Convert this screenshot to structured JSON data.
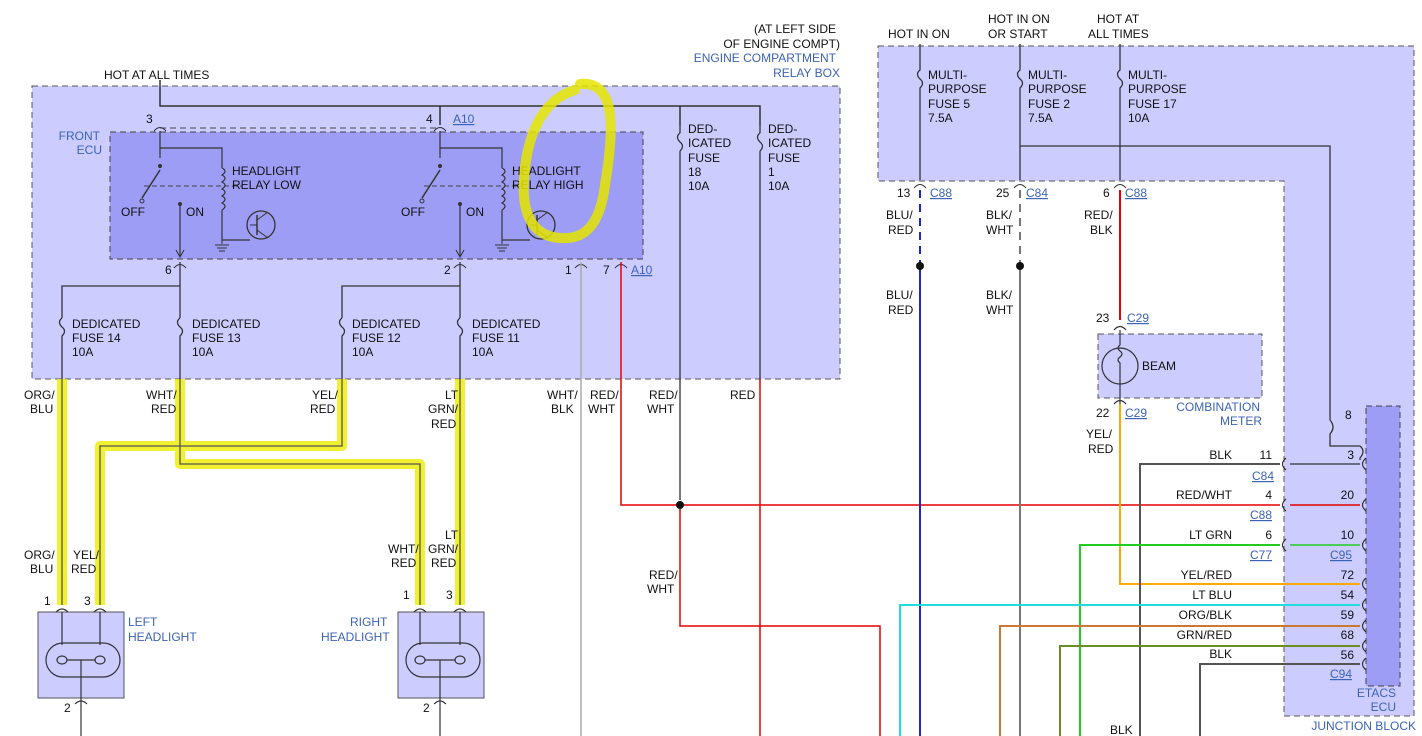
{
  "colors": {
    "box_fill": "#ccccff",
    "ecu_fill": "#9d9df5",
    "wire_red": "#e60000",
    "wire_blue": "#2222cc",
    "wire_gray": "#777777",
    "wire_black": "#222222",
    "wire_green": "#22cc22",
    "wire_cyan": "#22dddd",
    "wire_yellow": "#ffaa00",
    "wire_orange": "#cc7733",
    "wire_olive": "#6b8e23",
    "highlight": "#eeee00"
  },
  "relay_box": {
    "location_l1": "(AT LEFT SIDE",
    "location_l2": "OF ENGINE COMPT)",
    "name_l1": "ENGINE COMPARTMENT",
    "name_l2": "RELAY BOX",
    "hot": "HOT AT ALL TIMES",
    "pin3": "3",
    "pin4": "4",
    "conn_a10": "A10",
    "pin6": "6",
    "pin2": "2",
    "pin1": "1",
    "pin7": "7",
    "conn_a10_b": "A10"
  },
  "front_ecu": {
    "l1": "FRONT",
    "l2": "ECU"
  },
  "relay_low": {
    "l1": "HEADLIGHT",
    "l2": "RELAY LOW",
    "off": "OFF",
    "on": "ON"
  },
  "relay_high": {
    "l1": "HEADLIGHT",
    "l2": "RELAY HIGH",
    "off": "OFF",
    "on": "ON"
  },
  "ded18": {
    "l1": "DED-",
    "l2": "ICATED",
    "l3": "FUSE",
    "l4": "18",
    "l5": "10A"
  },
  "ded1": {
    "l1": "DED-",
    "l2": "ICATED",
    "l3": "FUSE",
    "l4": "1",
    "l5": "10A"
  },
  "fuse14": {
    "l1": "DEDICATED",
    "l2": "FUSE 14",
    "l3": "10A"
  },
  "fuse13": {
    "l1": "DEDICATED",
    "l2": "FUSE 13",
    "l3": "10A"
  },
  "fuse12": {
    "l1": "DEDICATED",
    "l2": "FUSE 12",
    "l3": "10A"
  },
  "fuse11": {
    "l1": "DEDICATED",
    "l2": "FUSE 11",
    "l3": "10A"
  },
  "wires_left": {
    "orgblu_a": "ORG/",
    "orgblu_b": "BLU",
    "whtred_a": "WHT/",
    "whtred_b": "RED",
    "yelred_a": "YEL/",
    "yelred_b": "RED",
    "ltgrnred_a": "LT",
    "ltgrnred_b": "GRN/",
    "ltgrnred_c": "RED",
    "whtblk_a": "WHT/",
    "whtblk_b": "BLK",
    "redwht1_a": "RED/",
    "redwht1_b": "WHT",
    "redwht2_a": "RED/",
    "redwht2_b": "WHT",
    "red": "RED",
    "redwht3_a": "RED/",
    "redwht3_b": "WHT"
  },
  "left_headlight": {
    "l1": "LEFT",
    "l2": "HEADLIGHT",
    "pin1": "1",
    "pin3": "3",
    "pin2": "2",
    "w1a": "ORG/",
    "w1b": "BLU",
    "w3a": "YEL/",
    "w3b": "RED"
  },
  "right_headlight": {
    "l1": "RIGHT",
    "l2": "HEADLIGHT",
    "pin1": "1",
    "pin3": "3",
    "pin2": "2",
    "w1a": "WHT/",
    "w1b": "RED",
    "w3a": "LT",
    "w3b": "GRN/",
    "w3c": "RED"
  },
  "junction": {
    "hot_on": "HOT IN ON",
    "hot_start_l1": "HOT IN ON",
    "hot_start_l2": "OR START",
    "hot_all_l1": "HOT AT",
    "hot_all_l2": "ALL TIMES",
    "fuse5": {
      "l1": "MULTI-",
      "l2": "PURPOSE",
      "l3": "FUSE 5",
      "l4": "7.5A"
    },
    "fuse2": {
      "l1": "MULTI-",
      "l2": "PURPOSE",
      "l3": "FUSE 2",
      "l4": "7.5A"
    },
    "fuse17": {
      "l1": "MULTI-",
      "l2": "PURPOSE",
      "l3": "FUSE 17",
      "l4": "10A"
    },
    "p13": "13",
    "c88a": "C88",
    "p25": "25",
    "c84a": "C84",
    "p6": "6",
    "c88b": "C88",
    "blured_a": "BLU/",
    "blured_b": "RED",
    "blkwht_a": "BLK/",
    "blkwht_b": "WHT",
    "redblk_a": "RED/",
    "redblk_b": "BLK",
    "blured2_a": "BLU/",
    "blured2_b": "RED",
    "blkwht2_a": "BLK/",
    "blkwht2_b": "WHT",
    "name": "JUNCTION BLOCK"
  },
  "combo_meter": {
    "p23": "23",
    "c29a": "C29",
    "beam": "BEAM",
    "p22": "22",
    "c29b": "C29",
    "l1": "COMBINATION",
    "l2": "METER",
    "yelred_a": "YEL/",
    "yelred_b": "RED"
  },
  "etacs": {
    "l1": "ETACS",
    "l2": "ECU",
    "p8": "8",
    "rows": [
      {
        "wire": "BLK",
        "left_pin": "11",
        "right_pin": "3",
        "conn": "C84"
      },
      {
        "wire": "RED/WHT",
        "left_pin": "4",
        "right_pin": "20",
        "conn": "C88"
      },
      {
        "wire": "LT GRN",
        "left_pin": "6",
        "right_pin": "10",
        "conn": "C77",
        "conn2": "C95"
      },
      {
        "wire": "YEL/RED",
        "right_pin": "72"
      },
      {
        "wire": "LT BLU",
        "right_pin": "54"
      },
      {
        "wire": "ORG/BLK",
        "right_pin": "59"
      },
      {
        "wire": "GRN/RED",
        "right_pin": "68"
      },
      {
        "wire": "BLK",
        "right_pin": "56",
        "conn": "C94"
      }
    ],
    "bottom_blk": "BLK"
  }
}
